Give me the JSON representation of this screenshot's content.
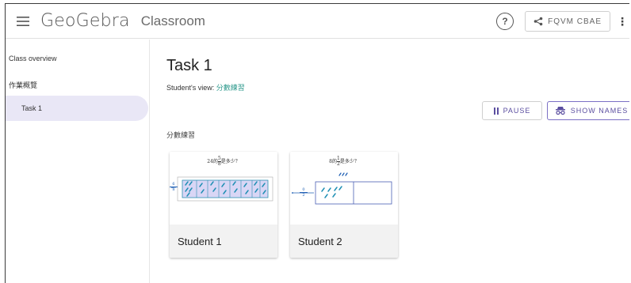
{
  "header": {
    "logo": "GeoGebra",
    "app_title": "Classroom",
    "help_icon": "help-circle-icon",
    "share_code": "FQVM CBAE",
    "more_icon": "more-vert-icon"
  },
  "sidebar": {
    "items": [
      {
        "label": "Class overview"
      },
      {
        "label": "作業概覽"
      },
      {
        "label": "Task 1",
        "active": true
      }
    ]
  },
  "main": {
    "title": "Task 1",
    "student_view_label": "Student's view:",
    "student_view_link": "分數練習",
    "pause_label": "PAUSE",
    "show_names_label": "SHOW NAMES",
    "section_label": "分數練習",
    "cards": [
      {
        "student": "Student 1",
        "question_prefix": "24的",
        "frac_num": "5",
        "frac_den": "8",
        "question_suffix": "是多少？",
        "axis_num": "6",
        "axis_den": "8"
      },
      {
        "student": "Student 2",
        "question_prefix": "8的",
        "frac_num": "1",
        "frac_den": "2",
        "question_suffix": "是多少？",
        "axis_num": "0",
        "axis_den": "2"
      }
    ]
  },
  "colors": {
    "accent": "#5b4ea0",
    "link": "#2f9a8d",
    "active_bg": "#e9e7f6",
    "bar_fill": "#d9d6f5",
    "stroke": "#2b8fb2"
  }
}
